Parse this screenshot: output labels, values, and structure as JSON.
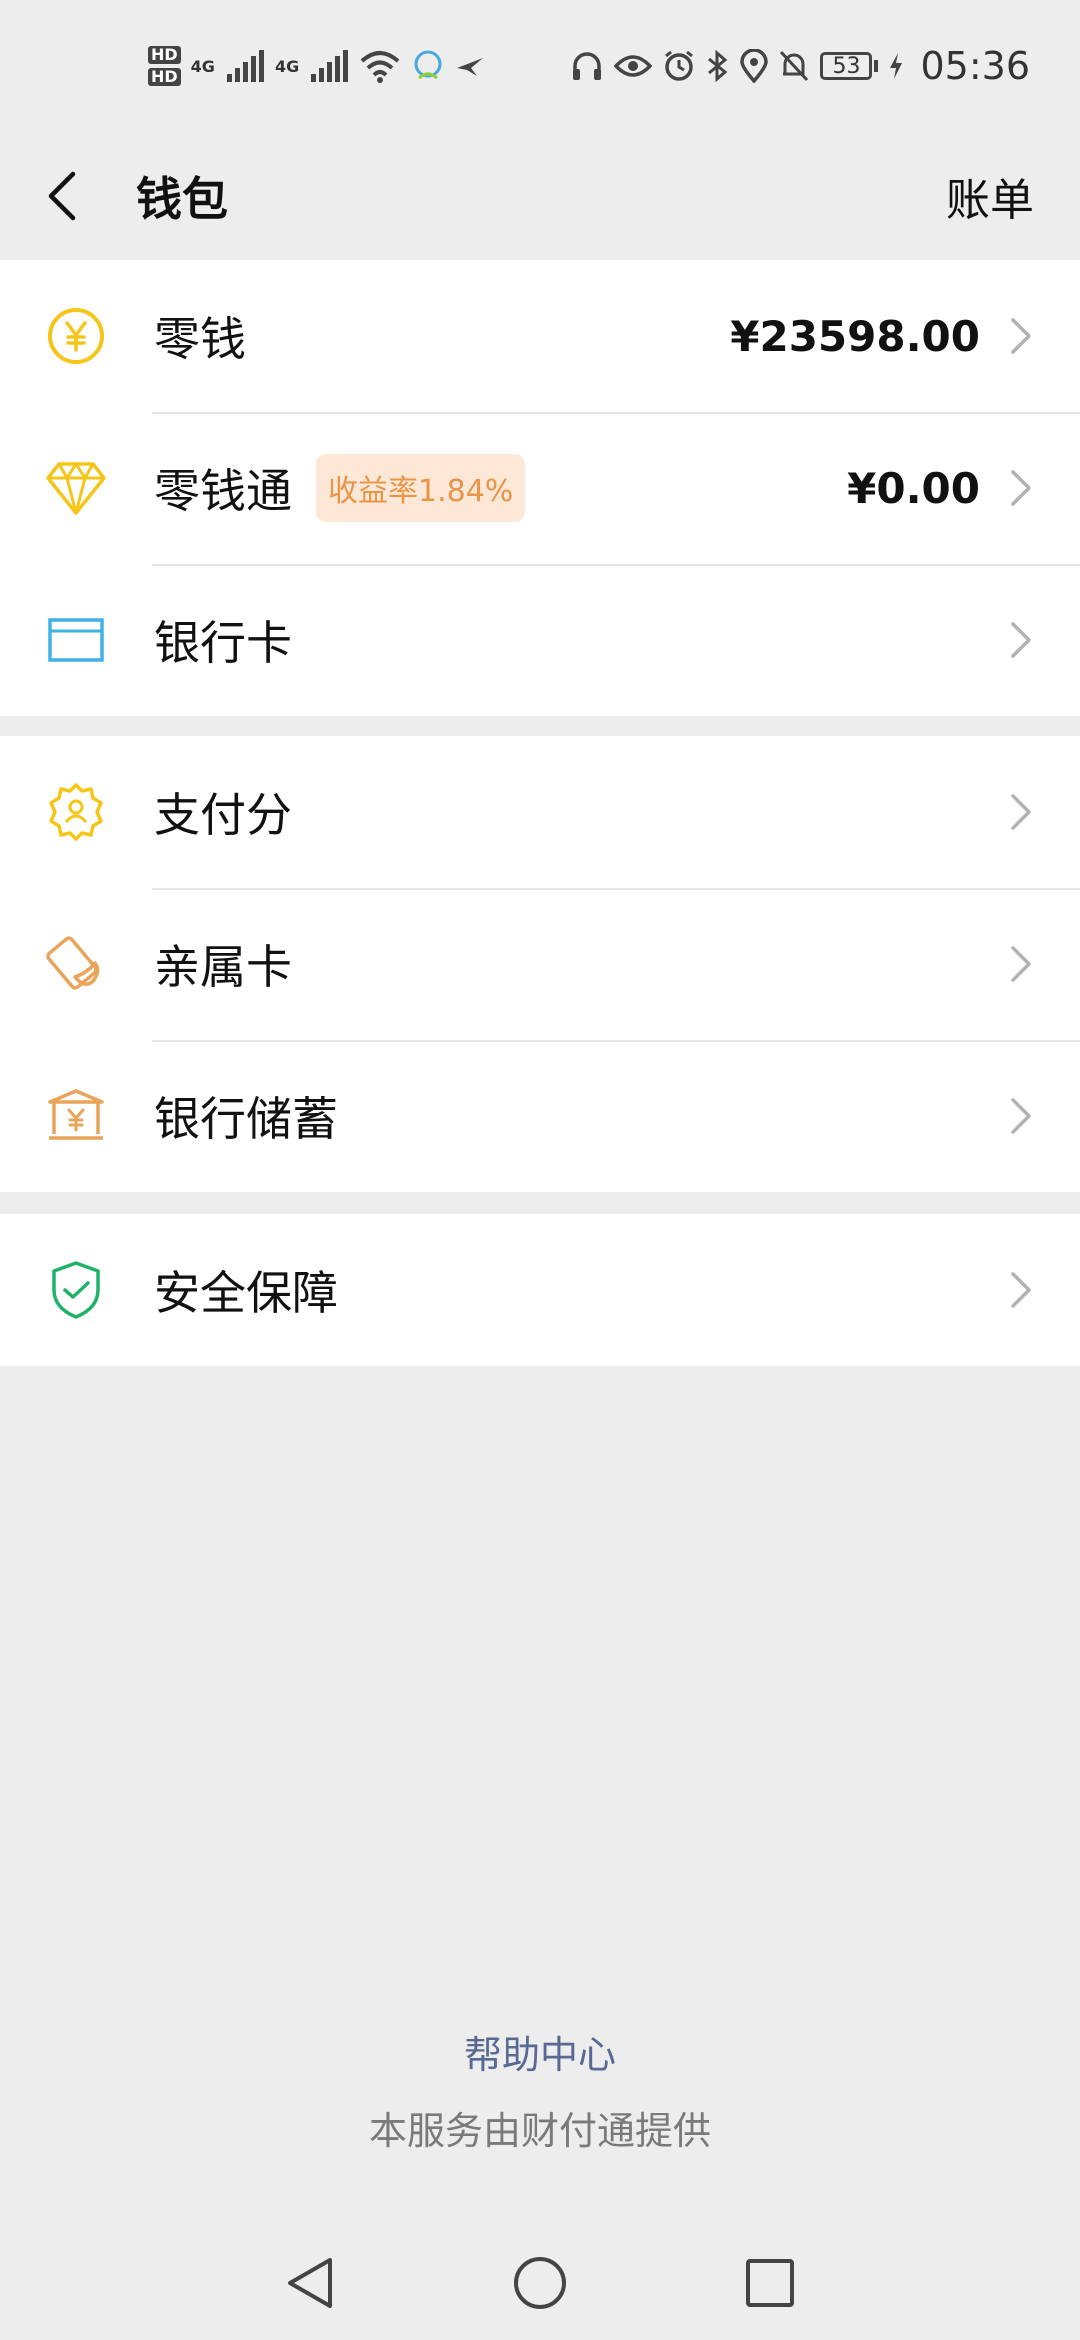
{
  "status_bar": {
    "sim1_label": "HD",
    "sim2_label": "HD",
    "network1": "4G",
    "network2": "4G",
    "battery_level": "53",
    "time": "05:36",
    "icons": [
      "signal-icon",
      "wifi-icon",
      "app-notification-icon",
      "headphone-icon",
      "eye-icon",
      "alarm-icon",
      "bluetooth-icon",
      "location-icon",
      "mute-icon",
      "charging-icon"
    ]
  },
  "header": {
    "title": "钱包",
    "bill_label": "账单"
  },
  "groups": {
    "finance": {
      "items": [
        {
          "label": "零钱",
          "value": "¥23598.00",
          "icon": "yuan-coin-icon"
        },
        {
          "label": "零钱通",
          "badge": "收益率1.84%",
          "value": "¥0.00",
          "icon": "diamond-icon"
        },
        {
          "label": "银行卡",
          "icon": "bank-card-icon"
        }
      ]
    },
    "services": {
      "items": [
        {
          "label": "支付分",
          "icon": "credit-score-icon"
        },
        {
          "label": "亲属卡",
          "icon": "family-card-icon"
        },
        {
          "label": "银行储蓄",
          "icon": "bank-savings-icon"
        }
      ]
    },
    "security": {
      "items": [
        {
          "label": "安全保障",
          "icon": "shield-check-icon"
        }
      ]
    }
  },
  "footer": {
    "help_center": "帮助中心",
    "provider": "本服务由财付通提供"
  },
  "colors": {
    "background": "#ededed",
    "yellow_icon": "#f5c518",
    "blue_icon": "#3fb2e6",
    "orange_icon": "#e9a45a",
    "green_icon": "#1fb36a",
    "badge_bg": "#fde8d8",
    "badge_text": "#e99447",
    "link_blue": "#586a93"
  }
}
